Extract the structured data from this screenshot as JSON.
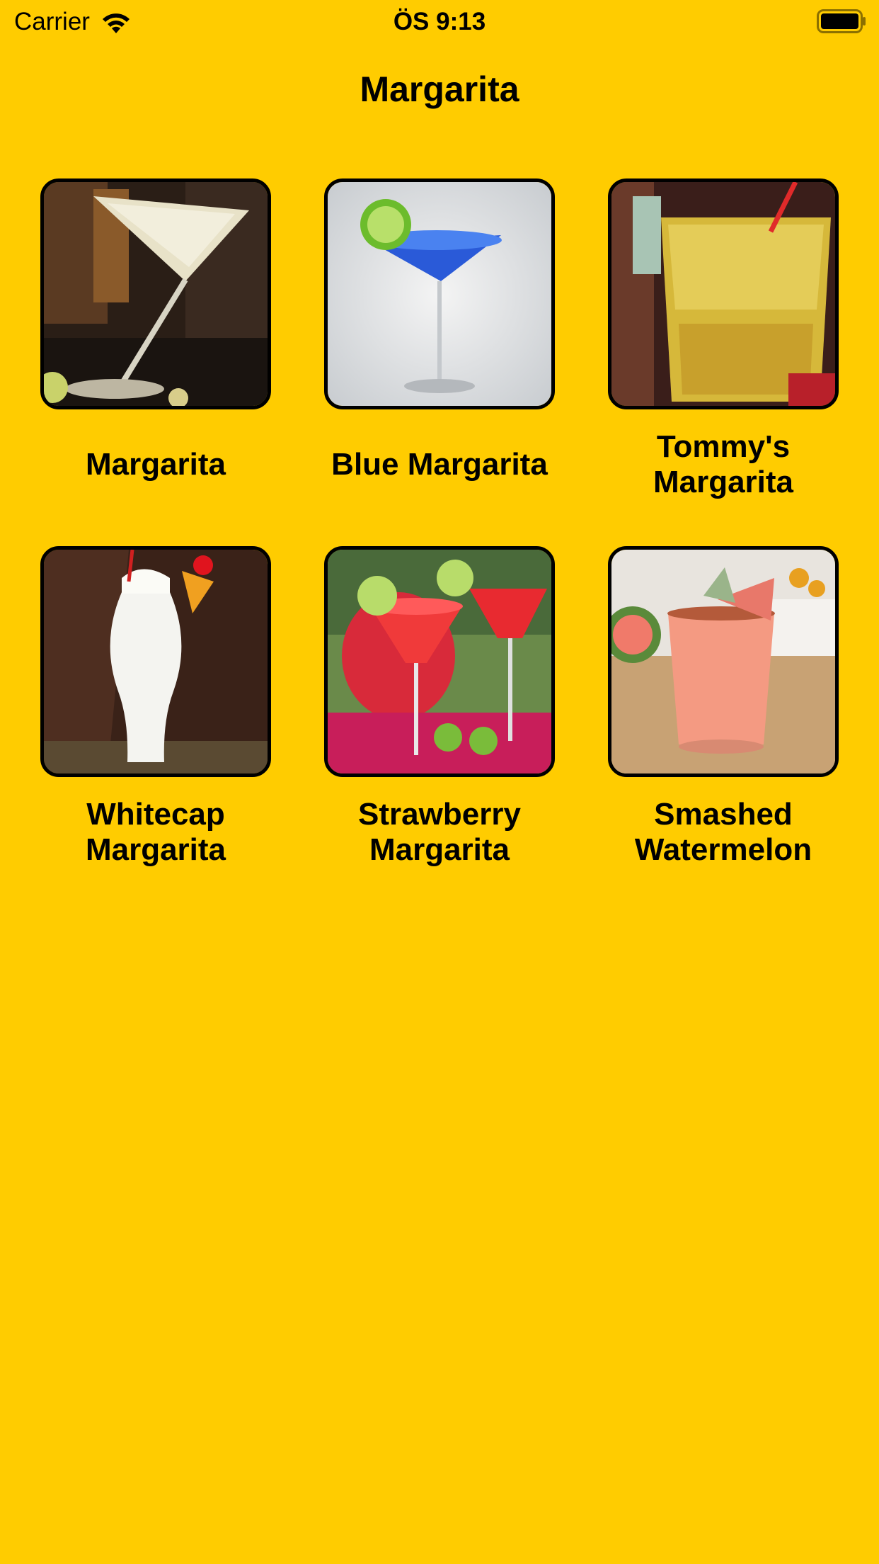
{
  "status_bar": {
    "carrier": "Carrier",
    "time": "ÖS 9:13",
    "wifi_icon": "wifi-icon",
    "battery_icon": "battery-icon"
  },
  "nav": {
    "title": "Margarita"
  },
  "colors": {
    "background": "#FFCC00",
    "text": "#000000",
    "thumb_border": "#000000"
  },
  "drinks": [
    {
      "name": "Margarita",
      "image": "cocktail-glass-clear"
    },
    {
      "name": "Blue Margarita",
      "image": "cocktail-glass-blue"
    },
    {
      "name": "Tommy's Margarita",
      "image": "tumbler-yellow"
    },
    {
      "name": "Whitecap Margarita",
      "image": "hurricane-glass-white"
    },
    {
      "name": "Strawberry Margarita",
      "image": "margarita-glasses-red"
    },
    {
      "name": "Smashed Watermelon",
      "image": "tumbler-pink"
    }
  ]
}
